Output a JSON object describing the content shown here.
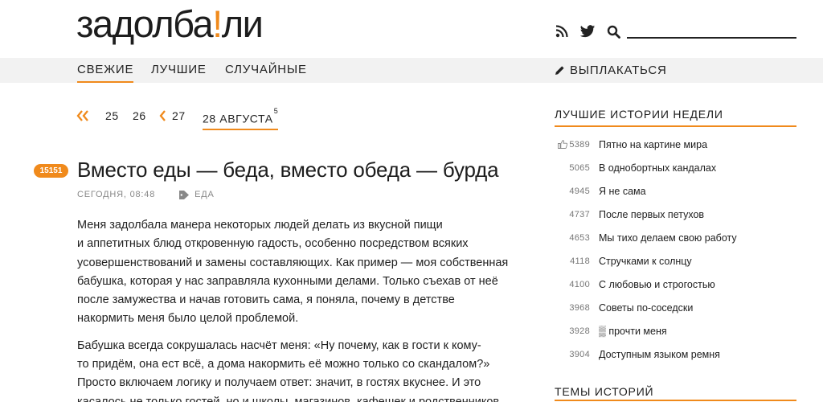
{
  "header": {
    "logo_part1": "задолба",
    "logo_bang": "!",
    "logo_part2": "ли",
    "icons": [
      "rss-icon",
      "twitter-icon",
      "search-icon"
    ],
    "search_placeholder": ""
  },
  "nav": {
    "items": [
      {
        "label": "СВЕЖИЕ",
        "active": true
      },
      {
        "label": "ЛУЧШИЕ",
        "active": false
      },
      {
        "label": "СЛУЧАЙНЫЕ",
        "active": false
      }
    ],
    "complain_label": "ВЫПЛАКАТЬСЯ"
  },
  "pager": {
    "pages": [
      "25",
      "26",
      "27"
    ],
    "current_label": "28 АВГУСТА",
    "current_count": "5"
  },
  "story": {
    "rating": "15151",
    "title": "Вместо еды — беда, вместо обеда — бурда",
    "date": "СЕГОДНЯ, 08:48",
    "tag": "ЕДА",
    "paragraphs": [
      "Меня задолбала манера некоторых людей делать из вкусной пищи\nи аппетитных блюд откровенную гадость, особенно посредством всяких\nусовершенствований и замены составляющих. Как пример — моя собственная\nбабушка, которая у нас заправляла кухонными делами. Только съехав от неё\nпосле замужества и начав готовить сама, я поняла, почему в детстве\nнакормить меня было целой проблемой.",
      "Бабушка всегда сокрушалась насчёт меня: «Ну почему, как в гости к кому-\nто придём, она ест всё, а дома накормить её можно только со скандалом?»\nПросто включаем логику и получаем ответ: значит, в гостях вкуснее. И это\nкасалось не только гостей, но и школы, магазинов, кафешек и родственников."
    ]
  },
  "sidebar": {
    "best_heading": "ЛУЧШИЕ ИСТОРИИ НЕДЕЛИ",
    "best": [
      {
        "count": "5389",
        "title": "Пятно на картине мира"
      },
      {
        "count": "5065",
        "title": "В однобортных кандалах"
      },
      {
        "count": "4945",
        "title": "Я не сама"
      },
      {
        "count": "4737",
        "title": "После первых петухов"
      },
      {
        "count": "4653",
        "title": "Мы тихо делаем свою работу"
      },
      {
        "count": "4118",
        "title": "Стручками к солнцу"
      },
      {
        "count": "4100",
        "title": "С любовью и строгостью"
      },
      {
        "count": "3968",
        "title": "Советы по-соседски"
      },
      {
        "count": "3928",
        "title": "▒ прочти меня"
      },
      {
        "count": "3904",
        "title": "Доступным языком ремня"
      }
    ],
    "topics_heading": "ТЕМЫ ИСТОРИЙ"
  },
  "colors": {
    "accent": "#f08a1c",
    "nav_bg": "#f2f2f2",
    "text": "#222222",
    "muted": "#888888"
  }
}
